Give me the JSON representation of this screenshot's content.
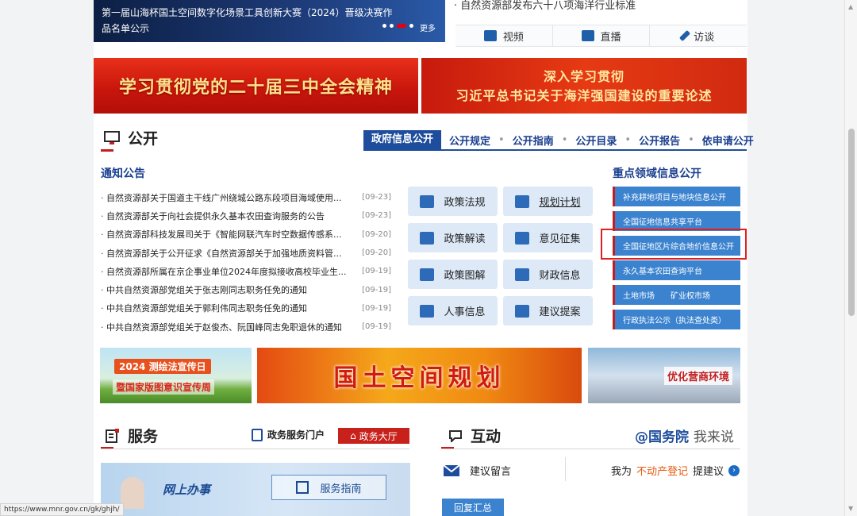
{
  "carousel": {
    "caption": "第一届山海杯国土空间数字化场景工具创新大赛（2024）晋级决赛作品名单公示",
    "more": "更多"
  },
  "top_news": "· 自然资源部发布六十八项海洋行业标准",
  "media": [
    {
      "label": "视频",
      "icon": "video-icon"
    },
    {
      "label": "直播",
      "icon": "live-tv-icon"
    },
    {
      "label": "访谈",
      "icon": "pen-icon"
    }
  ],
  "banners": {
    "left": "学习贯彻党的二十届三中全会精神",
    "right_line1": "深入学习贯彻",
    "right_line2": "习近平总书记关于海洋强国建设的重要论述"
  },
  "gongkai": {
    "title": "公开",
    "tabs": [
      "政府信息公开",
      "公开规定",
      "公开指南",
      "公开目录",
      "公开报告",
      "依申请公开"
    ],
    "active_tab": "政府信息公开"
  },
  "notices": {
    "title": "通知公告",
    "items": [
      {
        "title": "自然资源部关于国道主干线广州绕城公路东段项目海域使用...",
        "date": "[09-23]"
      },
      {
        "title": "自然资源部关于向社会提供永久基本农田查询服务的公告",
        "date": "[09-23]"
      },
      {
        "title": "自然资源部科技发展司关于《智能网联汽车时空数据传感系...",
        "date": "[09-20]"
      },
      {
        "title": "自然资源部关于公开征求《自然资源部关于加强地质资料管...",
        "date": "[09-20]"
      },
      {
        "title": "自然资源部所属在京企事业单位2024年度拟接收高校毕业生...",
        "date": "[09-19]"
      },
      {
        "title": "中共自然资源部党组关于张志刚同志职务任免的通知",
        "date": "[09-19]"
      },
      {
        "title": "中共自然资源部党组关于郭利伟同志职务任免的通知",
        "date": "[09-19]"
      },
      {
        "title": "中共自然资源部党组关于赵俊杰、阮国峰同志免职退休的通知",
        "date": "[09-19]"
      }
    ]
  },
  "quick": [
    {
      "label": "政策法规",
      "icon": "gavel-icon"
    },
    {
      "label": "规划计划",
      "icon": "grid-calendar-icon"
    },
    {
      "label": "政策解读",
      "icon": "document-icon"
    },
    {
      "label": "意见征集",
      "icon": "edit-icon"
    },
    {
      "label": "政策图解",
      "icon": "book-icon"
    },
    {
      "label": "财政信息",
      "icon": "ledger-icon"
    },
    {
      "label": "人事信息",
      "icon": "people-icon"
    },
    {
      "label": "建议提案",
      "icon": "clipboard-icon"
    }
  ],
  "focus": {
    "title": "重点领域信息公开",
    "items": [
      "补充耕地项目与地块信息公开",
      "全国征地信息共享平台",
      "全国征地区片综合地价信息公开",
      "永久基本农田查询平台",
      "土地市场　　矿业权市场",
      "行政执法公示（执法查处类）"
    ]
  },
  "promos": {
    "p1_line1": "2024 测绘法宣传日",
    "p1_line2": "暨国家版图意识宣传周",
    "p2": "国土空间规划",
    "p3": "优化营商环境"
  },
  "service": {
    "title": "服务",
    "portal": "政务服务门户",
    "hall": "政务大厅",
    "online": "网上办事",
    "guide": "服务指南"
  },
  "interaction": {
    "title": "互动",
    "right_brand": "@国务院",
    "right_say": "我来说",
    "message": "建议留言",
    "suggest_pre": "我为",
    "suggest_hl": "不动产登记",
    "suggest_post": "提建议",
    "reply": "回复汇总"
  },
  "status_url": "https://www.mnr.gov.cn/gk/ghjh/"
}
